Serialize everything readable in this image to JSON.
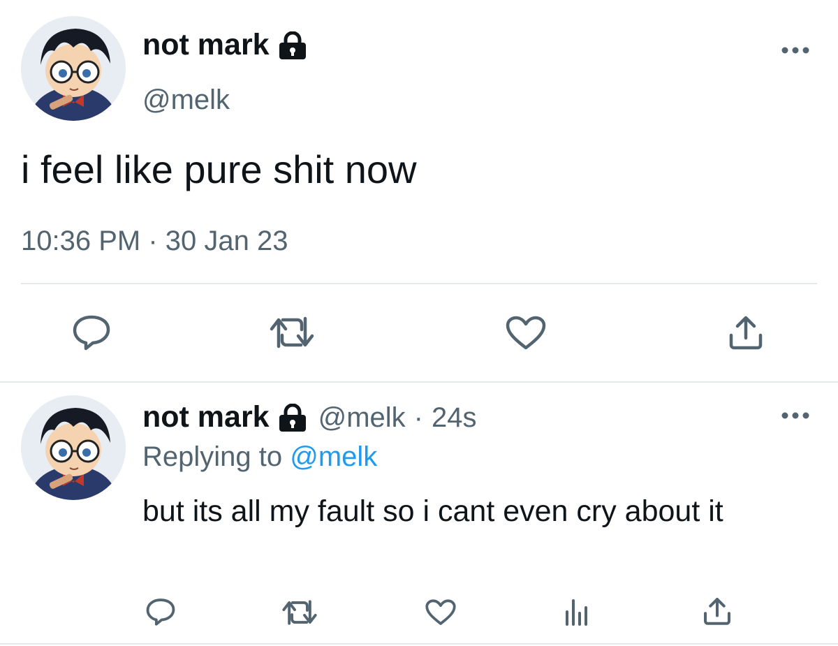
{
  "main_tweet": {
    "author_name": "not mark",
    "author_handle": "@melk",
    "protected_icon": "lock-icon",
    "more_icon": "more-horizontal-icon",
    "text": "i feel like pure shit now",
    "timestamp": "10:36 PM · 30 Jan 23",
    "actions": [
      "reply-icon",
      "retweet-icon",
      "like-icon",
      "share-icon"
    ]
  },
  "reply_tweet": {
    "author_name": "not mark",
    "author_handle": "@melk",
    "separator": "·",
    "age": "24s",
    "replying_prefix": "Replying to",
    "replying_handle": "@melk",
    "text": "but its all my fault so i cant even cry about it",
    "actions": [
      "reply-icon",
      "retweet-icon",
      "like-icon",
      "analytics-icon",
      "share-icon"
    ]
  },
  "colors": {
    "text": "#0f1419",
    "secondary": "#536471",
    "accent": "#1d9bf0",
    "divider": "#e6e9ec"
  }
}
